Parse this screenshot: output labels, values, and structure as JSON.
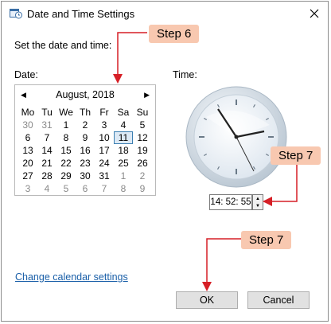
{
  "window": {
    "title": "Date and Time Settings",
    "app_icon": "calendar-clock-icon",
    "close_icon": "close-icon"
  },
  "prompt": "Set the date and time:",
  "date_label": "Date:",
  "time_label": "Time:",
  "calendar": {
    "month_year": "August, 2018",
    "prev_icon": "chevron-left-icon",
    "next_icon": "chevron-right-icon",
    "weekdays": [
      "Mo",
      "Tu",
      "We",
      "Th",
      "Fr",
      "Sa",
      "Su"
    ],
    "weeks": [
      [
        "30",
        "31",
        "1",
        "2",
        "3",
        "4",
        "5"
      ],
      [
        "6",
        "7",
        "8",
        "9",
        "10",
        "11",
        "12"
      ],
      [
        "13",
        "14",
        "15",
        "16",
        "17",
        "18",
        "19"
      ],
      [
        "20",
        "21",
        "22",
        "23",
        "24",
        "25",
        "26"
      ],
      [
        "27",
        "28",
        "29",
        "30",
        "31",
        "1",
        "2"
      ],
      [
        "3",
        "4",
        "5",
        "6",
        "7",
        "8",
        "9"
      ]
    ],
    "selected": "11"
  },
  "time_value": "14: 52: 55",
  "change_calendar_link": "Change calendar settings",
  "buttons": {
    "ok": "OK",
    "cancel": "Cancel"
  },
  "annotations": {
    "step6": "Step 6",
    "step7_time": "Step 7",
    "step7_ok": "Step 7",
    "color": "#f8c8b0",
    "arrow_color": "#d61f26"
  }
}
